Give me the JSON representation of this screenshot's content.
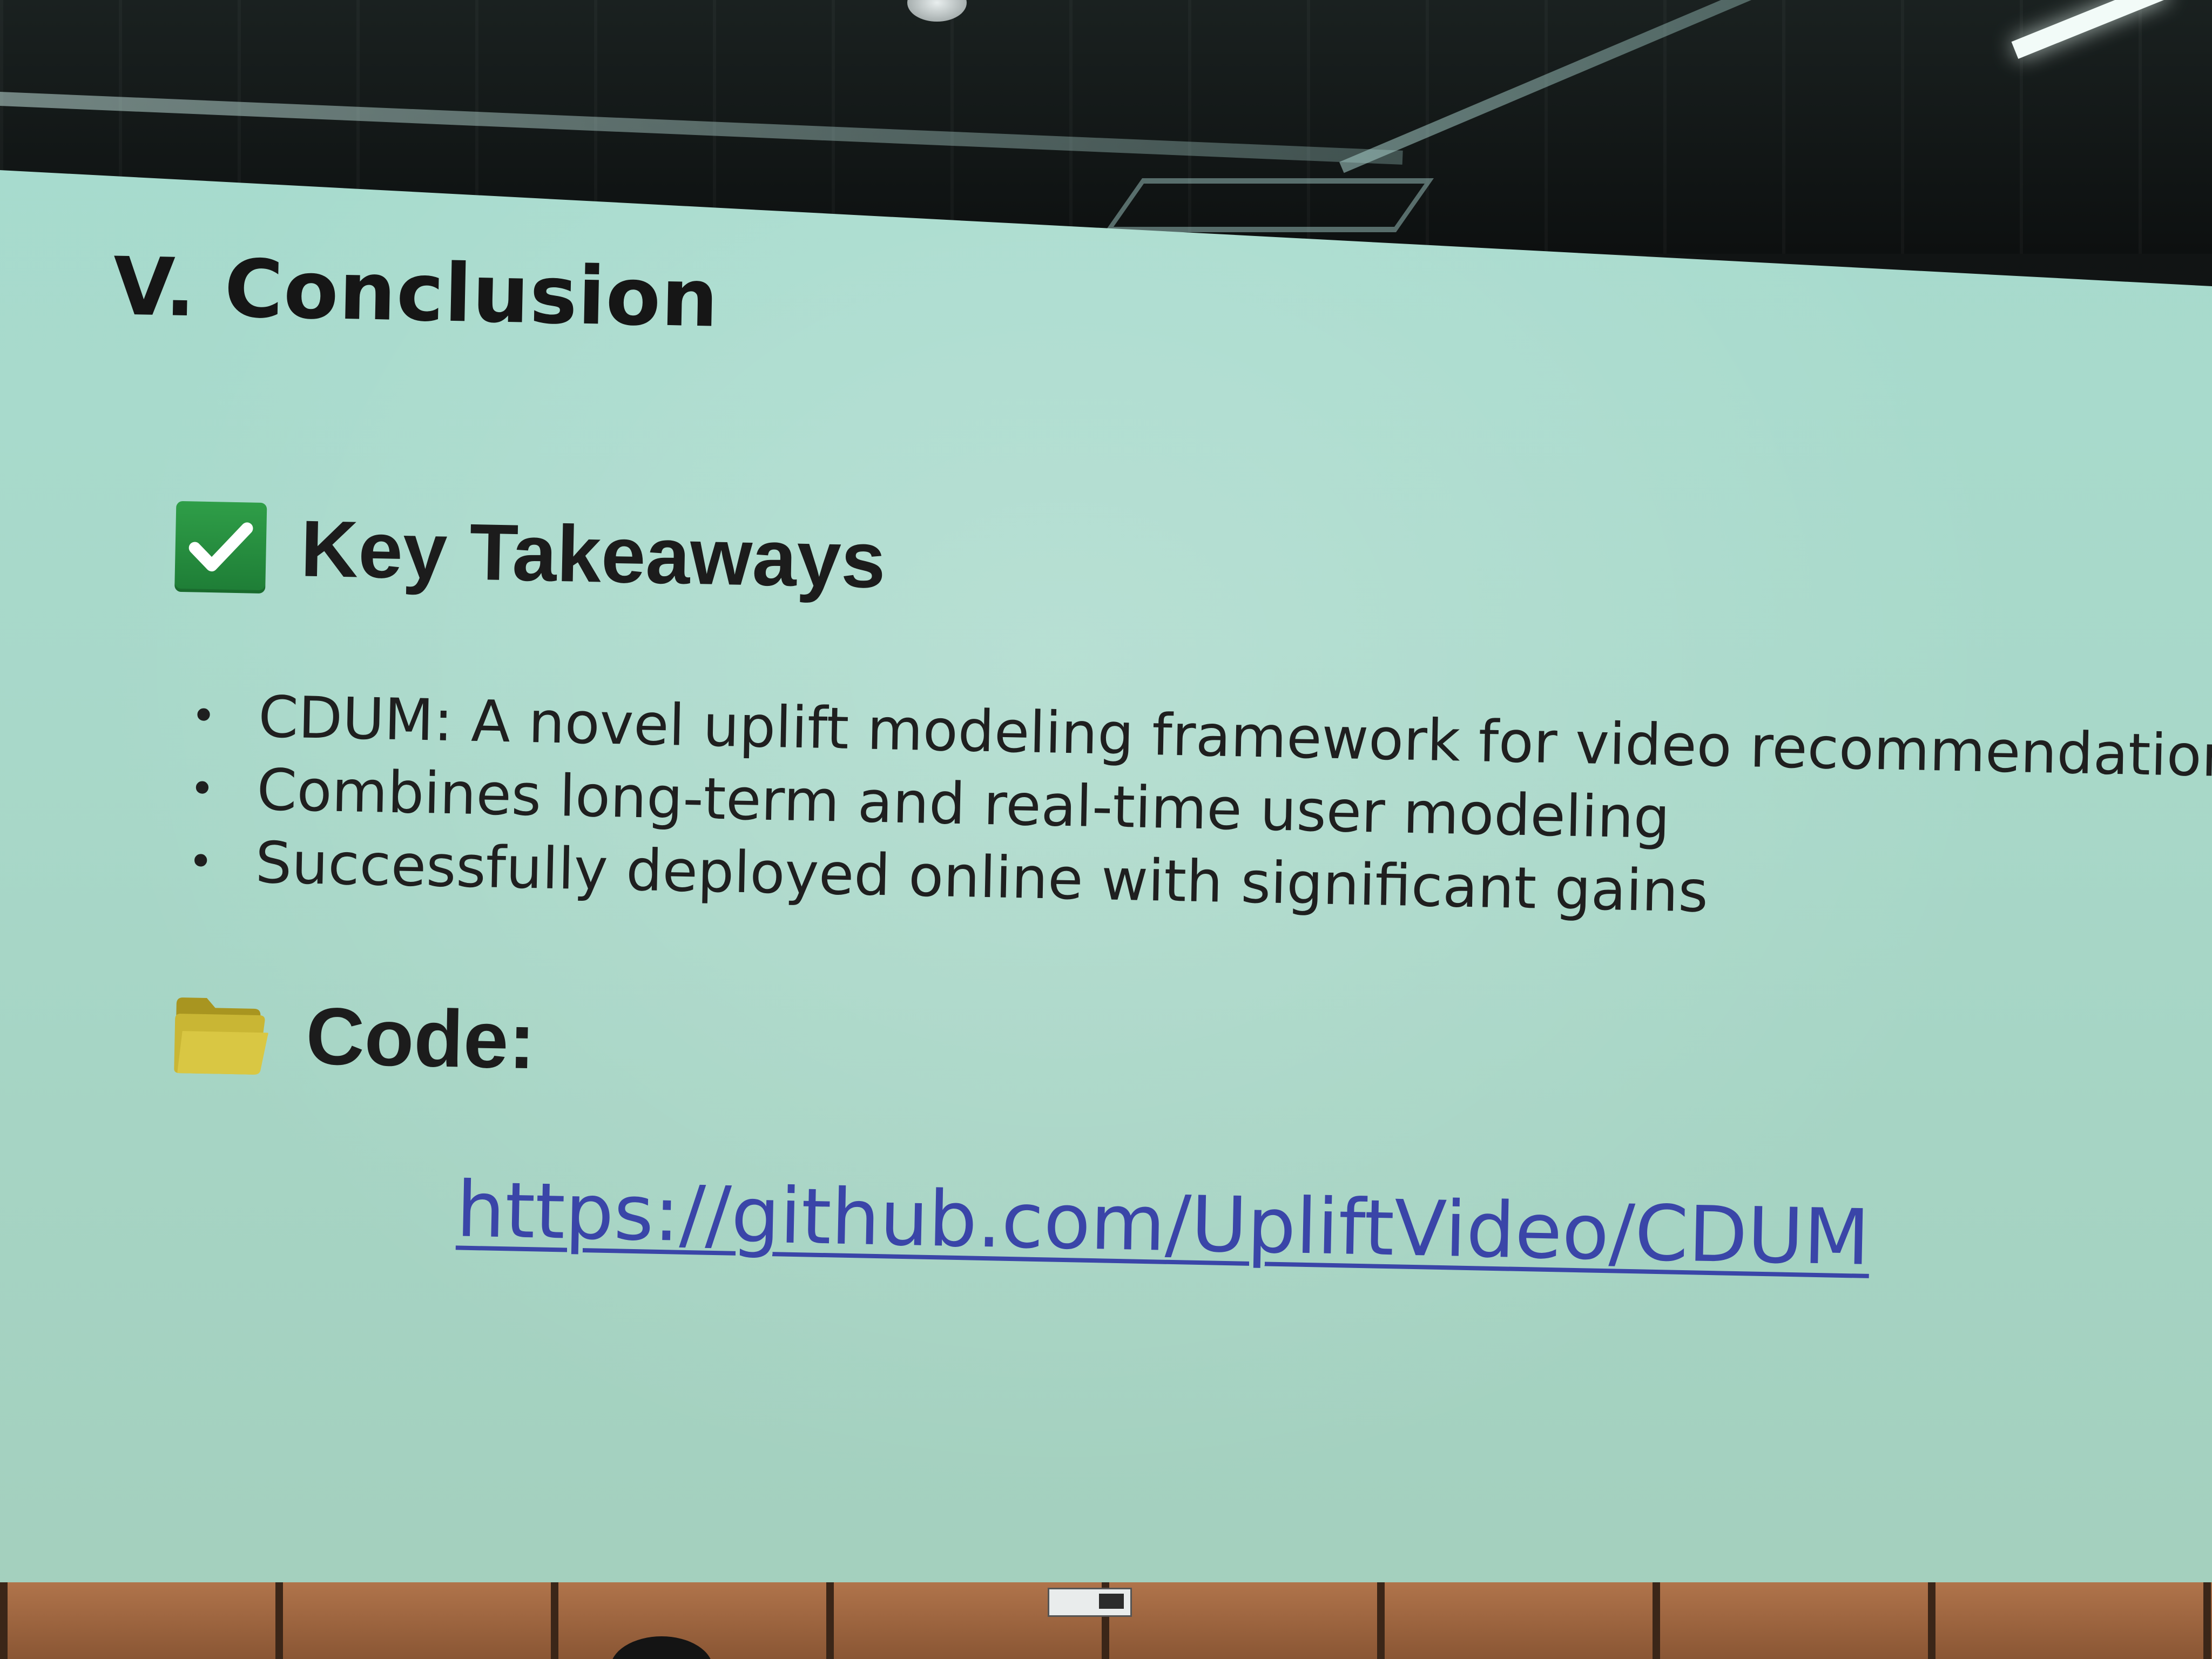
{
  "slide": {
    "title": "V. Conclusion",
    "takeaways": {
      "icon": "checkbox-checked-icon",
      "heading": "Key Takeaways",
      "bullets": [
        "CDUM: A novel uplift modeling framework for video recommendation",
        "Combines long-term and real-time user modeling",
        "Successfully deployed online with significant gains"
      ]
    },
    "code": {
      "icon": "folder-icon",
      "heading": "Code:",
      "link": "https://github.com/UpliftVideo/CDUM"
    }
  },
  "colors": {
    "screen": "#a7dccf",
    "text": "#1e1e1e",
    "link": "#3a45a8",
    "check_icon": "#2f9e48",
    "folder_icon": "#c9b634"
  }
}
